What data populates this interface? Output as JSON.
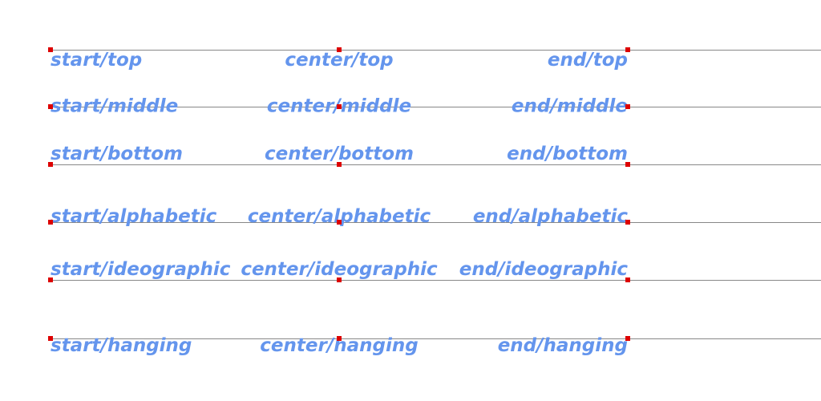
{
  "colors": {
    "text": "#6495ED",
    "baseline": "#888888",
    "anchor_marker": "#DD0000",
    "background": "#ffffff"
  },
  "aligns": [
    "start",
    "center",
    "end"
  ],
  "rows": [
    {
      "baseline": "top",
      "labels": [
        "start/top",
        "center/top",
        "end/top"
      ]
    },
    {
      "baseline": "middle",
      "labels": [
        "start/middle",
        "center/middle",
        "end/middle"
      ]
    },
    {
      "baseline": "bottom",
      "labels": [
        "start/bottom",
        "center/bottom",
        "end/bottom"
      ]
    },
    {
      "baseline": "alphabetic",
      "labels": [
        "start/alphabetic",
        "center/alphabetic",
        "end/alphabetic"
      ]
    },
    {
      "baseline": "ideographic",
      "labels": [
        "start/ideographic",
        "center/ideographic",
        "end/ideographic"
      ]
    },
    {
      "baseline": "hanging",
      "labels": [
        "start/hanging",
        "center/hanging",
        "end/hanging"
      ]
    }
  ]
}
